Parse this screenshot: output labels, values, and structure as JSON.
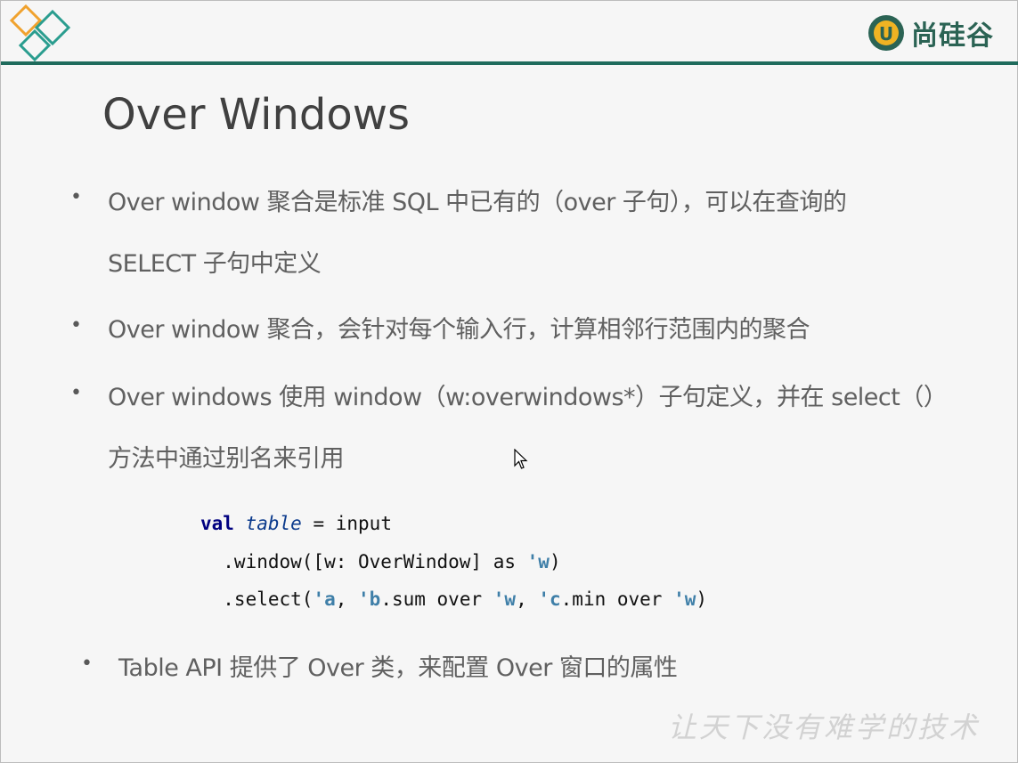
{
  "brand": {
    "name": "尚硅谷",
    "logo_letter": "U"
  },
  "slide": {
    "title": "Over Windows",
    "bullets": [
      {
        "line1": "Over window 聚合是标准 SQL 中已有的（over 子句），可以在查询的",
        "line2": "SELECT 子句中定义"
      },
      {
        "line1": "Over window 聚合，会针对每个输入行，计算相邻行范围内的聚合"
      },
      {
        "line1": "Over windows 使用 window（w:overwindows*）子句定义，并在 select（）",
        "line2": "方法中通过别名来引用"
      },
      {
        "line1": "Table API 提供了 Over 类，来配置 Over 窗口的属性"
      }
    ],
    "bullet_char": "•",
    "code": {
      "line1_kw": "val",
      "line1_var": "table",
      "line1_rest": " = input",
      "line2_a": "  .window([w: OverWindow] as ",
      "line2_sym": "'w",
      "line2_b": ")",
      "line3_a": "  .select(",
      "line3_s1": "'a",
      "line3_b": ", ",
      "line3_s2": "'b",
      "line3_c": ".sum over ",
      "line3_s3": "'w",
      "line3_d": ", ",
      "line3_s4": "'c",
      "line3_e": ".min over ",
      "line3_s5": "'w",
      "line3_f": ")"
    },
    "watermark": "让天下没有难学的技术"
  },
  "colors": {
    "header_line": "#1f6b5c",
    "brand": "#2b6354",
    "diamond_orange": "#f0a22e",
    "diamond_teal": "#2a9d8f"
  }
}
